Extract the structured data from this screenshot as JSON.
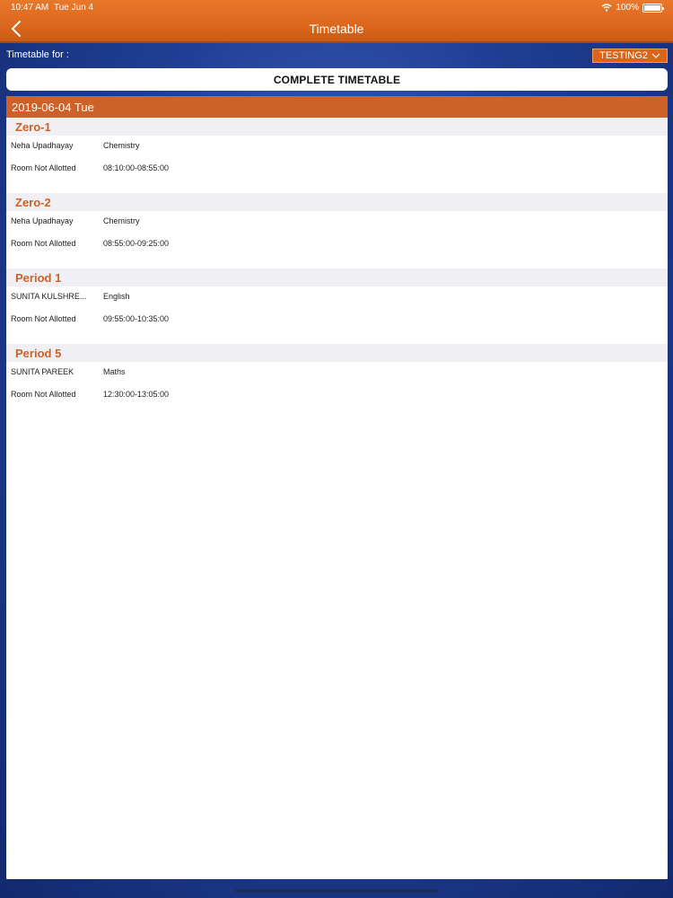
{
  "status": {
    "time": "10:47 AM",
    "date": "Tue Jun 4",
    "battery": "100%",
    "wifi_icon": "wifi-icon",
    "battery_icon": "battery-icon"
  },
  "nav": {
    "title": "Timetable",
    "back_icon": "chevron-left-icon"
  },
  "filter": {
    "label": "Timetable for :",
    "selected": "TESTING2",
    "dropdown_icon": "chevron-down-icon"
  },
  "complete_button": "COMPLETE TIMETABLE",
  "day": {
    "label": "2019-06-04 Tue"
  },
  "periods": [
    {
      "name": "Zero-1",
      "teacher": "Neha  Upadhayay",
      "subject": "Chemistry",
      "room": "Room Not Allotted",
      "time": "08:10:00-08:55:00"
    },
    {
      "name": "Zero-2",
      "teacher": "Neha  Upadhayay",
      "subject": "Chemistry",
      "room": "Room Not Allotted",
      "time": "08:55:00-09:25:00"
    },
    {
      "name": "Period 1",
      "teacher": "SUNITA  KULSHRE...",
      "subject": "English",
      "room": "Room Not Allotted",
      "time": "09:55:00-10:35:00"
    },
    {
      "name": "Period 5",
      "teacher": "SUNITA  PAREEK",
      "subject": "Maths",
      "room": "Room Not Allotted",
      "time": "12:30:00-13:05:00"
    }
  ],
  "colors": {
    "header": "#e07020",
    "accent": "#cd6128",
    "background": "#1f3f94"
  }
}
